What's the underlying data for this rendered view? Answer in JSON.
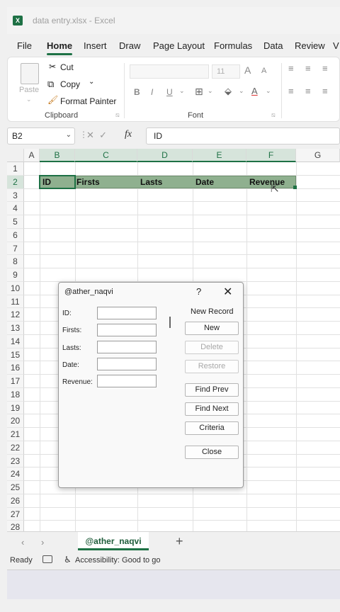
{
  "window": {
    "title": "data entry.xlsx - Excel",
    "app_logo": "X"
  },
  "tabs": [
    "File",
    "Home",
    "Insert",
    "Draw",
    "Page Layout",
    "Formulas",
    "Data",
    "Review",
    "V"
  ],
  "ribbon": {
    "paste": "Paste",
    "cut": "Cut",
    "copy": "Copy",
    "format_painter": "Format Painter",
    "clipboard_label": "Clipboard",
    "font_size": "11",
    "font_label": "Font",
    "bold": "B",
    "italic": "I",
    "underline": "U",
    "font_color": "A",
    "grow": "A",
    "shrink": "A"
  },
  "formula_bar": {
    "name_box": "B2",
    "fx": "fx",
    "value": "ID"
  },
  "grid": {
    "columns": [
      "A",
      "B",
      "C",
      "D",
      "E",
      "F",
      "G"
    ],
    "rows": [
      "1",
      "2",
      "3",
      "4",
      "5",
      "6",
      "7",
      "8",
      "9",
      "10",
      "11",
      "12",
      "13",
      "14",
      "15",
      "16",
      "17",
      "18",
      "19",
      "20",
      "21",
      "22",
      "23",
      "24",
      "25",
      "26",
      "27",
      "28"
    ],
    "header_row": [
      "ID",
      "Firsts",
      "Lasts",
      "Date",
      "Revenue"
    ]
  },
  "dialog": {
    "title": "@ather_naqvi",
    "help": "?",
    "close": "✕",
    "record_status": "New Record",
    "fields": [
      {
        "label": "ID:",
        "value": ""
      },
      {
        "label": "Firsts:",
        "value": ""
      },
      {
        "label": "Lasts:",
        "value": ""
      },
      {
        "label": "Date:",
        "value": ""
      },
      {
        "label": "Revenue:",
        "value": ""
      }
    ],
    "buttons": {
      "new": "New",
      "delete": "Delete",
      "restore": "Restore",
      "find_prev": "Find Prev",
      "find_next": "Find Next",
      "criteria": "Criteria",
      "close": "Close"
    }
  },
  "sheet_tabs": {
    "active": "@ather_naqvi",
    "add": "+",
    "prev": "‹",
    "next": "›"
  },
  "status": {
    "ready": "Ready",
    "accessibility": "Accessibility: Good to go"
  },
  "colors": {
    "accent": "#1e7145",
    "header_fill": "#8fb08f"
  }
}
